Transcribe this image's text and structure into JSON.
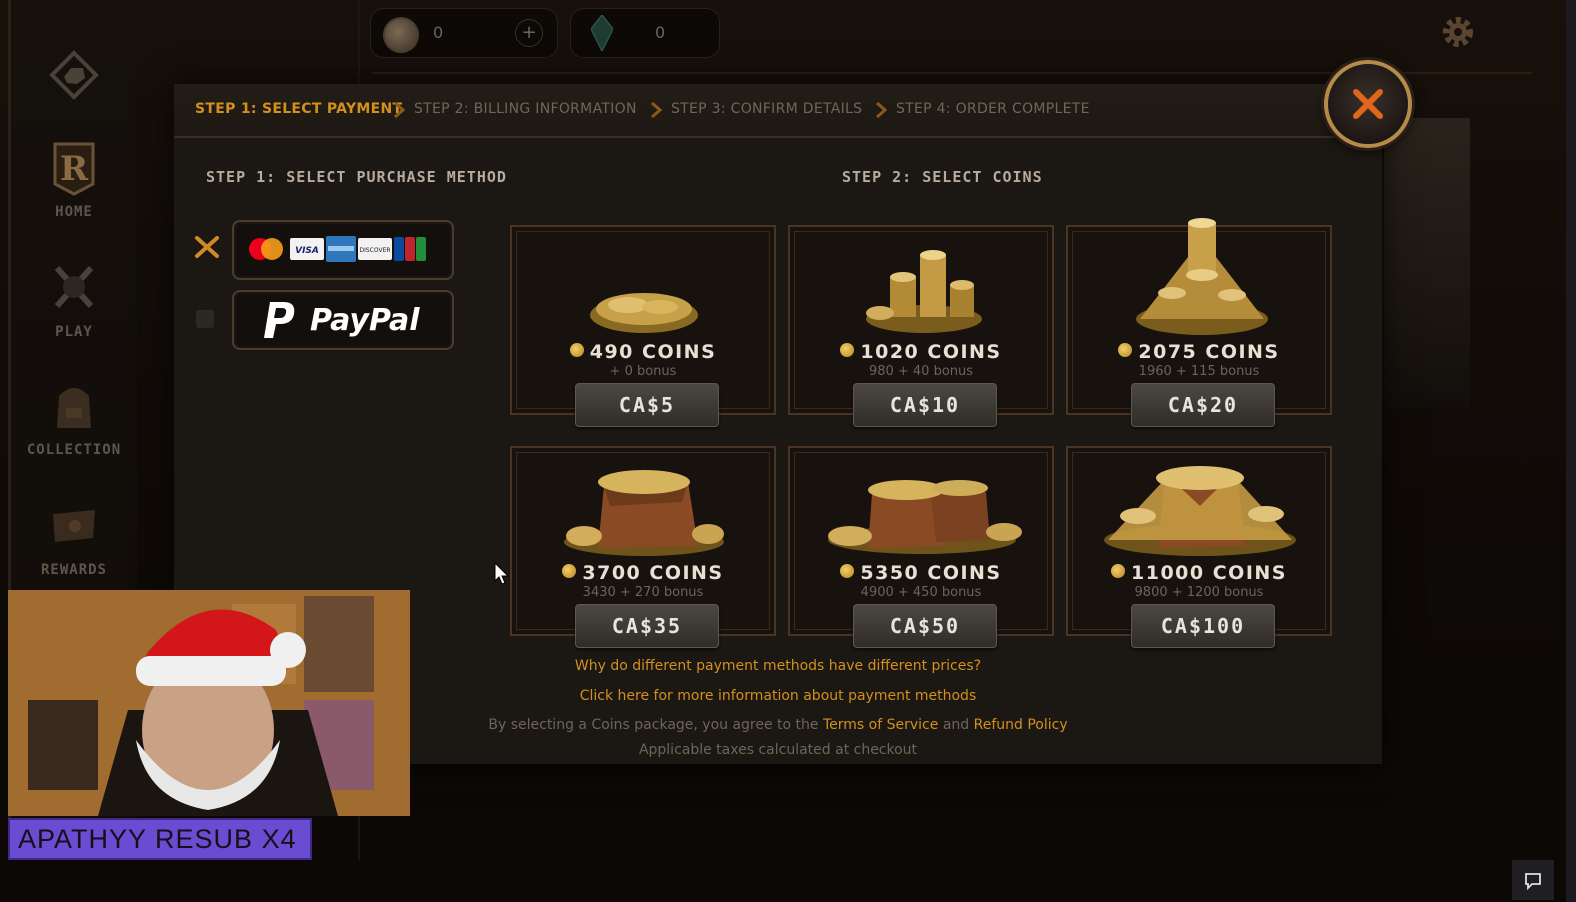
{
  "top_currency": {
    "coins_value": "0",
    "shards_value": "0"
  },
  "sidebar": {
    "items": [
      {
        "label": "HOME"
      },
      {
        "label": "PLAY"
      },
      {
        "label": "COLLECTION"
      },
      {
        "label": "REWARDS"
      }
    ]
  },
  "steps": [
    {
      "label": "STEP 1: SELECT PAYMENT"
    },
    {
      "label": "STEP 2: BILLING INFORMATION"
    },
    {
      "label": "STEP 3: CONFIRM DETAILS"
    },
    {
      "label": "STEP 4: ORDER COMPLETE"
    }
  ],
  "purchase_method": {
    "heading": "STEP 1: SELECT PURCHASE METHOD",
    "selected": "cards",
    "card_brands": [
      "Mastercard",
      "VISA",
      "Amex",
      "DISCOVER",
      "JCB"
    ],
    "paypal_label": "PayPal"
  },
  "coins": {
    "heading": "STEP 2: SELECT COINS",
    "packages": [
      {
        "title": "490 COINS",
        "sub": "+ 0 bonus",
        "price": "CA$5"
      },
      {
        "title": "1020 COINS",
        "sub": "980 + 40 bonus",
        "price": "CA$10"
      },
      {
        "title": "2075 COINS",
        "sub": "1960 + 115 bonus",
        "price": "CA$20"
      },
      {
        "title": "3700 COINS",
        "sub": "3430 + 270 bonus",
        "price": "CA$35"
      },
      {
        "title": "5350 COINS",
        "sub": "4900 + 450 bonus",
        "price": "CA$50"
      },
      {
        "title": "11000 COINS",
        "sub": "9800 + 1200 bonus",
        "price": "CA$100"
      }
    ]
  },
  "footer": {
    "link1": "Why do different payment methods have different prices?",
    "link2": "Click here for more information about payment methods",
    "agree_prefix": "By selecting a Coins package, you agree to the",
    "tos": "Terms of Service",
    "and": "and",
    "refund": "Refund Policy",
    "taxes": "Applicable taxes calculated at checkout"
  },
  "overlay": {
    "sub_text": "APATHYY  RESUB X4"
  },
  "colors": {
    "accent": "#d3901d",
    "sub_banner": "#6a4cd2"
  }
}
